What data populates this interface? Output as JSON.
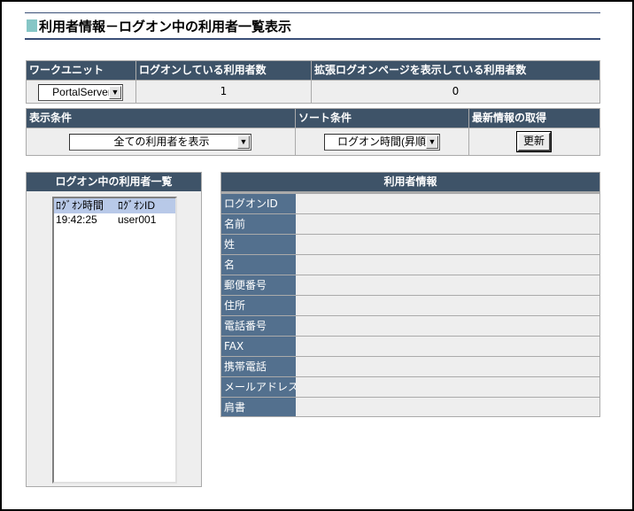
{
  "page_title": "利用者情報－ログオン中の利用者一覧表示",
  "top_table": {
    "headers": {
      "work_unit": "ワークユニット",
      "logged_on_count": "ログオンしている利用者数",
      "extended_page_count": "拡張ログオンページを表示している利用者数"
    },
    "work_unit_select": "PortalServer",
    "logged_on_count": "1",
    "extended_page_count": "0"
  },
  "condition_table": {
    "headers": {
      "display_condition": "表示条件",
      "sort_condition": "ソート条件",
      "refresh": "最新情報の取得"
    },
    "display_select": "全ての利用者を表示",
    "sort_select": "ログオン時間(昇順)",
    "refresh_button": "更新"
  },
  "user_list": {
    "header": "ログオン中の利用者一覧",
    "columns": [
      "ﾛｸﾞｵﾝ時間",
      "ﾛｸﾞｵﾝID"
    ],
    "rows": [
      {
        "time": "19:42:25",
        "id": "user001"
      }
    ]
  },
  "user_info": {
    "header": "利用者情報",
    "fields": [
      "ログオンID",
      "名前",
      "姓",
      "名",
      "郵便番号",
      "住所",
      "電話番号",
      "FAX",
      "携帯電話",
      "メールアドレス",
      "肩書"
    ]
  },
  "colors": {
    "header_bg": "#3e5368",
    "label_bg": "#53708e",
    "cell_bg": "#eeeeee",
    "title_mark": "#86c6c6"
  },
  "icons": {
    "dropdown": "chevron-down-icon"
  }
}
